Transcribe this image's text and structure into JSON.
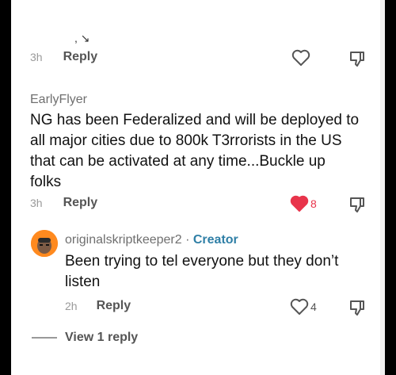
{
  "comments": [
    {
      "time": "3h",
      "reply_label": "Reply"
    },
    {
      "username": "EarlyFlyer",
      "text_lines": [
        "NG has been Federalized and will be deployed to",
        "all major cities due to 800k T3rrorists in the US",
        "that can be activated at any time...Buckle up",
        "folks"
      ],
      "time": "3h",
      "reply_label": "Reply",
      "like_count": "8",
      "liked": true
    },
    {
      "username": "originalskriptkeeper2",
      "separator": " · ",
      "badge": "Creator",
      "text_lines": [
        "Been trying to tel everyone but they don’t",
        "listen"
      ],
      "time": "2h",
      "reply_label": "Reply",
      "like_count": "4",
      "liked": false
    }
  ],
  "view_replies": "View 1 reply",
  "colors": {
    "like_red": "#e8344b",
    "creator_blue": "#2f7fa6",
    "avatar_orange": "#ff8a1f"
  },
  "icons": {
    "heart": "heart-icon",
    "dislike": "thumbs-down-icon"
  }
}
